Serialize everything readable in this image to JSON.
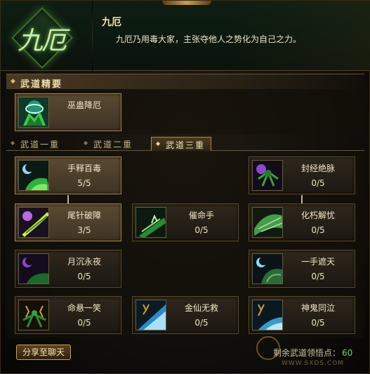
{
  "header": {
    "emblem_text": "九厄",
    "title": "九厄",
    "description": "九厄乃用毒大家，主张夺他人之势化为自己之力。"
  },
  "essentials": {
    "section_label": "武道精要",
    "skill": {
      "name": "巫蛊降厄",
      "icon": "mask-poison-icon"
    }
  },
  "tabs": [
    {
      "label": "武道一重",
      "selected": false
    },
    {
      "label": "武道二重",
      "selected": false
    },
    {
      "label": "武道三重",
      "selected": true
    }
  ],
  "skills": [
    {
      "name": "手释百毒",
      "level": "5/5",
      "icon": "moon-poison-icon",
      "active": true
    },
    {
      "name": "封经绝脉",
      "level": "0/5",
      "icon": "spider-demon-icon",
      "active": false
    },
    {
      "name": "尾针破障",
      "level": "3/5",
      "icon": "needle-tail-icon",
      "active": true
    },
    {
      "name": "催命手",
      "level": "0/5",
      "icon": "claw-strike-icon",
      "active": false
    },
    {
      "name": "化朽解忧",
      "level": "0/5",
      "icon": "wing-leaf-icon",
      "active": false
    },
    {
      "name": "月沉永夜",
      "level": "0/5",
      "icon": "moon-night-icon",
      "active": false
    },
    {
      "name": "一手遮天",
      "level": "0/5",
      "icon": "shadow-hand-icon",
      "active": false
    },
    {
      "name": "命悬一笑",
      "level": "0/5",
      "icon": "laughing-demon-icon",
      "active": false
    },
    {
      "name": "金仙无救",
      "level": "0/5",
      "icon": "golden-blade-icon",
      "active": false
    },
    {
      "name": "神鬼同泣",
      "level": "0/5",
      "icon": "ghost-trident-icon",
      "active": false
    }
  ],
  "footer": {
    "share_label": "分享至聊天",
    "remaining_label": "剩余武道领悟点：",
    "remaining_value": "60"
  },
  "watermark": {
    "url": "WWW.SXDS.COM"
  },
  "colors": {
    "accent_gold": "#c8a25a",
    "points_green": "#7fd060",
    "panel_brown": "#2e271c"
  }
}
